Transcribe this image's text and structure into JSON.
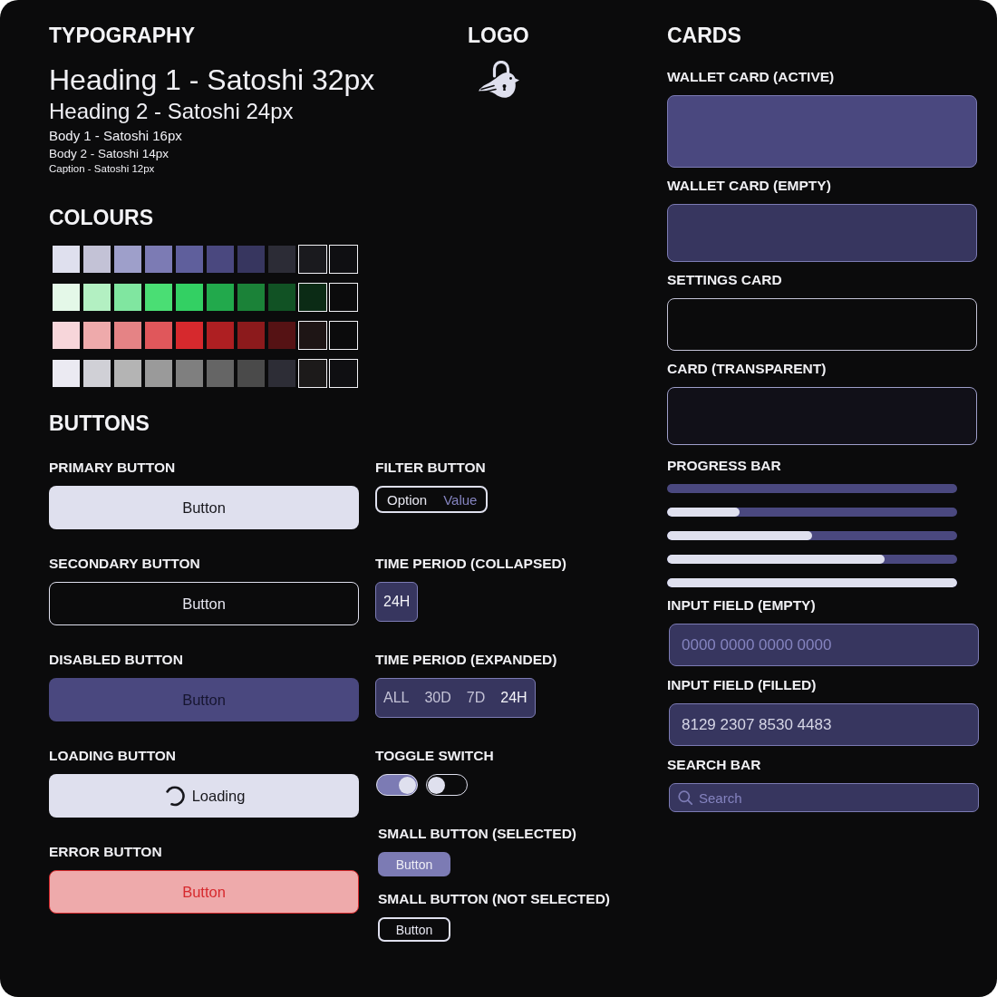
{
  "typography": {
    "title": "TYPOGRAPHY",
    "samples": [
      {
        "kind": "h1",
        "text": "Heading 1 - Satoshi 32px"
      },
      {
        "kind": "h2",
        "text": "Heading 2 - Satoshi 24px"
      },
      {
        "kind": "body1",
        "text": "Body 1 - Satoshi 16px"
      },
      {
        "kind": "body2",
        "text": "Body 2 - Satoshi 14px"
      },
      {
        "kind": "caption",
        "text": "Caption - Satoshi 12px"
      }
    ]
  },
  "logo": {
    "title": "LOGO"
  },
  "colours": {
    "title": "COLOURS",
    "rows": [
      {
        "swatches": [
          {
            "color": "#dfe0ee",
            "outlined": false
          },
          {
            "color": "#c3c2d6",
            "outlined": false
          },
          {
            "color": "#9e9fca",
            "outlined": false
          },
          {
            "color": "#7c7bb4",
            "outlined": false
          },
          {
            "color": "#5f5f9c",
            "outlined": false
          },
          {
            "color": "#4a487f",
            "outlined": false
          },
          {
            "color": "#37365f",
            "outlined": false
          },
          {
            "color": "#2c2c36",
            "outlined": false
          },
          {
            "color": "#1a1a1e",
            "outlined": true
          },
          {
            "color": "#0f0f12",
            "outlined": true
          }
        ]
      },
      {
        "swatches": [
          {
            "color": "#e4f8e8",
            "outlined": false
          },
          {
            "color": "#b3f0c2",
            "outlined": false
          },
          {
            "color": "#80e6a0",
            "outlined": false
          },
          {
            "color": "#4ade74",
            "outlined": false
          },
          {
            "color": "#33d063",
            "outlined": false
          },
          {
            "color": "#22a94c",
            "outlined": false
          },
          {
            "color": "#1b8238",
            "outlined": false
          },
          {
            "color": "#115224",
            "outlined": false
          },
          {
            "color": "#0b2b15",
            "outlined": true
          },
          {
            "color": "#0b0b0c",
            "outlined": true
          }
        ]
      },
      {
        "swatches": [
          {
            "color": "#f7d6da",
            "outlined": false
          },
          {
            "color": "#eeaaab",
            "outlined": false
          },
          {
            "color": "#e58385",
            "outlined": false
          },
          {
            "color": "#e0575b",
            "outlined": false
          },
          {
            "color": "#d6292d",
            "outlined": false
          },
          {
            "color": "#ae1f22",
            "outlined": false
          },
          {
            "color": "#8c1a1c",
            "outlined": false
          },
          {
            "color": "#551214",
            "outlined": false
          },
          {
            "color": "#1e1515",
            "outlined": true
          },
          {
            "color": "#0b0b0c",
            "outlined": true
          }
        ]
      },
      {
        "swatches": [
          {
            "color": "#ebeaf2",
            "outlined": false
          },
          {
            "color": "#d0d0d6",
            "outlined": false
          },
          {
            "color": "#b4b4b4",
            "outlined": false
          },
          {
            "color": "#9a9a9a",
            "outlined": false
          },
          {
            "color": "#7f7f7f",
            "outlined": false
          },
          {
            "color": "#656565",
            "outlined": false
          },
          {
            "color": "#4a4a4a",
            "outlined": false
          },
          {
            "color": "#2d2d36",
            "outlined": false
          },
          {
            "color": "#1c1a1a",
            "outlined": true
          },
          {
            "color": "#0f0f12",
            "outlined": true
          }
        ]
      }
    ]
  },
  "buttons": {
    "title": "BUTTONS",
    "left": [
      {
        "label": "PRIMARY BUTTON",
        "kind": "primary",
        "text": "Button"
      },
      {
        "label": "SECONDARY BUTTON",
        "kind": "secondary",
        "text": "Button"
      },
      {
        "label": "DISABLED BUTTON",
        "kind": "disabled",
        "text": "Button"
      },
      {
        "label": "LOADING BUTTON",
        "kind": "loading",
        "text": "Loading"
      },
      {
        "label": "ERROR BUTTON",
        "kind": "error",
        "text": "Button"
      }
    ],
    "right": [
      {
        "label": "FILTER BUTTON",
        "kind": "filter",
        "option": "Option",
        "value": "Value"
      },
      {
        "label": "TIME PERIOD (COLLAPSED)",
        "kind": "period",
        "options": [
          {
            "text": "24H",
            "selected": true
          }
        ]
      },
      {
        "label": "TIME PERIOD (EXPANDED)",
        "kind": "period",
        "options": [
          {
            "text": "ALL",
            "selected": false
          },
          {
            "text": "30D",
            "selected": false
          },
          {
            "text": "7D",
            "selected": false
          },
          {
            "text": "24H",
            "selected": true
          }
        ]
      },
      {
        "label": "TOGGLE SWITCH",
        "kind": "toggles",
        "switches": [
          {
            "on": true
          },
          {
            "on": false
          }
        ]
      },
      {
        "label": "SMALL BUTTON (SELECTED)",
        "kind": "small",
        "text": "Button",
        "selected": true
      },
      {
        "label": "SMALL BUTTON (NOT SELECTED)",
        "kind": "small",
        "text": "Button",
        "selected": false
      }
    ]
  },
  "cards": {
    "title": "CARDS",
    "items": [
      {
        "label": "WALLET CARD (ACTIVE)",
        "kind": "wallet_active"
      },
      {
        "label": "WALLET CARD (EMPTY)",
        "kind": "wallet_empty"
      },
      {
        "label": "SETTINGS CARD",
        "kind": "settings"
      },
      {
        "label": "CARD (TRANSPARENT)",
        "kind": "transparent"
      }
    ],
    "progress": {
      "label": "PROGRESS BAR",
      "bars": [
        {
          "level": 0
        },
        {
          "level": 0.25
        },
        {
          "level": 0.5
        },
        {
          "level": 0.75
        },
        {
          "level": 1
        }
      ]
    },
    "inputs": [
      {
        "label": "INPUT FIELD (EMPTY)",
        "placeholder": "0000 0000 0000 0000"
      },
      {
        "label": "INPUT FIELD (FILLED)",
        "value": "8129 2307 8530 4483"
      }
    ],
    "search": {
      "label": "SEARCH BAR",
      "placeholder": "Search"
    }
  }
}
